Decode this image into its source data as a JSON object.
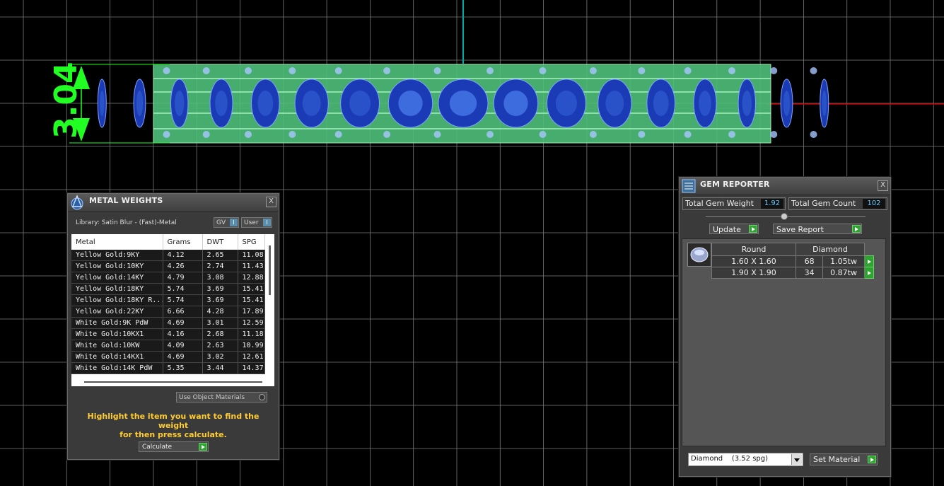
{
  "viewport": {
    "dimension_label": "3.04",
    "colors": {
      "grid": "#7a7a7a",
      "dimension": "#22ff22",
      "metal": "#4fc07a",
      "gem": "#1a3bb5",
      "axis_x": "#cc0000",
      "axis_y": "#00aaaa"
    }
  },
  "metal_weights": {
    "title": "METAL WEIGHTS",
    "close_label": "X",
    "library_label": "Library: Satin Blur - (Fast)-Metal",
    "gv_label": "GV",
    "user_label": "User",
    "columns": [
      "Metal",
      "Grams",
      "DWT",
      "SPG"
    ],
    "rows": [
      {
        "metal": "Yellow Gold:9KY",
        "grams": "4.12",
        "dwt": "2.65",
        "spg": "11.08"
      },
      {
        "metal": "Yellow Gold:10KY",
        "grams": "4.26",
        "dwt": "2.74",
        "spg": "11.43"
      },
      {
        "metal": "Yellow Gold:14KY",
        "grams": "4.79",
        "dwt": "3.08",
        "spg": "12.88"
      },
      {
        "metal": "Yellow Gold:18KY",
        "grams": "5.74",
        "dwt": "3.69",
        "spg": "15.41"
      },
      {
        "metal": "Yellow Gold:18KY R...",
        "grams": "5.74",
        "dwt": "3.69",
        "spg": "15.41"
      },
      {
        "metal": "Yellow Gold:22KY",
        "grams": "6.66",
        "dwt": "4.28",
        "spg": "17.89"
      },
      {
        "metal": "White Gold:9K PdW",
        "grams": "4.69",
        "dwt": "3.01",
        "spg": "12.59"
      },
      {
        "metal": "White Gold:10KX1",
        "grams": "4.16",
        "dwt": "2.68",
        "spg": "11.18"
      },
      {
        "metal": "White Gold:10KW",
        "grams": "4.09",
        "dwt": "2.63",
        "spg": "10.99"
      },
      {
        "metal": "White Gold:14KX1",
        "grams": "4.69",
        "dwt": "3.02",
        "spg": "12.61"
      },
      {
        "metal": "White Gold:14K PdW",
        "grams": "5.35",
        "dwt": "3.44",
        "spg": "14.37"
      }
    ],
    "use_object_materials_label": "Use Object Materials",
    "hint_line1": "Highlight the item you want to find the weight",
    "hint_line2": "for then press calculate.",
    "calculate_label": "Calculate"
  },
  "gem_reporter": {
    "title": "GEM REPORTER",
    "close_label": "X",
    "total_weight_label": "Total Gem Weight",
    "total_weight_value": "1.92",
    "total_count_label": "Total Gem Count",
    "total_count_value": "102",
    "update_label": "Update",
    "save_report_label": "Save Report",
    "table_headers": [
      "Round",
      "Diamond"
    ],
    "rows": [
      {
        "size": "1.60 X 1.60",
        "count": "68",
        "weight": "1.05tw"
      },
      {
        "size": "1.90 X 1.90",
        "count": "34",
        "weight": "0.87tw"
      }
    ],
    "material_select": "Diamond    (3.52 spg)",
    "set_material_label": "Set Material"
  }
}
